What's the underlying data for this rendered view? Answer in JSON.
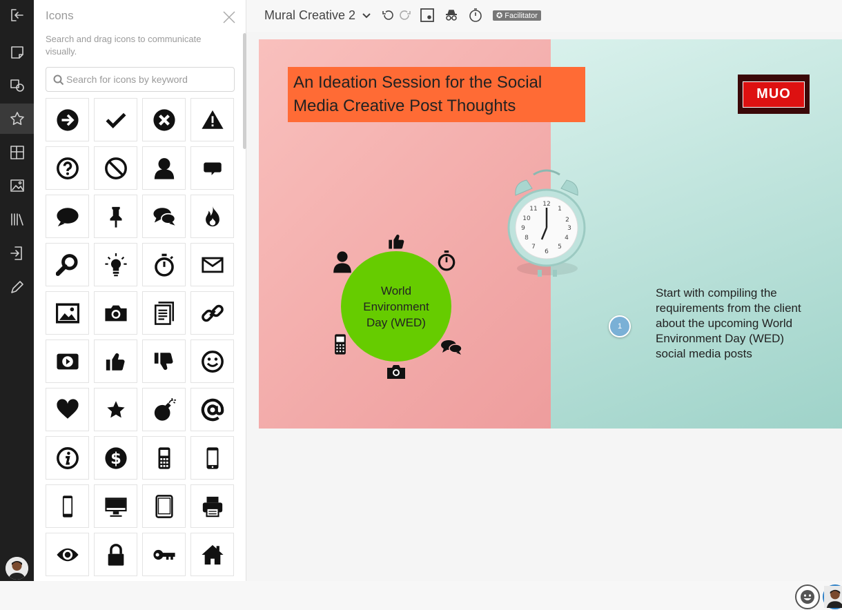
{
  "app": {
    "mural_title": "Mural Creative 2",
    "role_badge": "Facilitator"
  },
  "rail": {
    "items": [
      "exit-icon",
      "sticky-note-icon",
      "shapes-icon",
      "star-icon",
      "templates-icon",
      "image-icon",
      "library-icon",
      "import-icon",
      "pencil-icon"
    ]
  },
  "icons_panel": {
    "title": "Icons",
    "description": "Search and drag icons to communicate visually.",
    "search_placeholder": "Search for icons by keyword",
    "icons": [
      "arrow-right-icon",
      "check-icon",
      "x-circle-icon",
      "warning-icon",
      "question-icon",
      "ban-icon",
      "user-icon",
      "speech-bubble-icon",
      "chat-bubble-icon",
      "pushpin-icon",
      "conversation-icon",
      "fire-icon",
      "search-icon",
      "lightbulb-icon",
      "stopwatch-icon",
      "envelope-icon",
      "picture-icon",
      "camera-icon",
      "document-icon",
      "link-icon",
      "video-icon",
      "thumbs-up-icon",
      "thumbs-down-icon",
      "smiley-icon",
      "heart-icon",
      "star-icon",
      "bomb-icon",
      "at-sign-icon",
      "info-icon",
      "dollar-icon",
      "feature-phone-icon",
      "smartphone-icon",
      "phone-icon",
      "monitor-icon",
      "tablet-icon",
      "printer-icon",
      "eye-icon",
      "padlock-icon",
      "key-icon",
      "home-icon"
    ]
  },
  "board": {
    "title": "An Ideation Session for the Social Media Creative Post Thoughts",
    "logo_text": "MUO",
    "circle_label": "World Environment Day (WED)",
    "note_text": "Start with compiling the requirements from the client about the upcoming World Environment Day (WED) social media posts",
    "pin_number": "1"
  },
  "colors": {
    "title_bg": "#ff6b35",
    "circle_bg": "#66cc00",
    "left_bg": "#f4b0ad",
    "right_bg": "#bfe6df"
  }
}
